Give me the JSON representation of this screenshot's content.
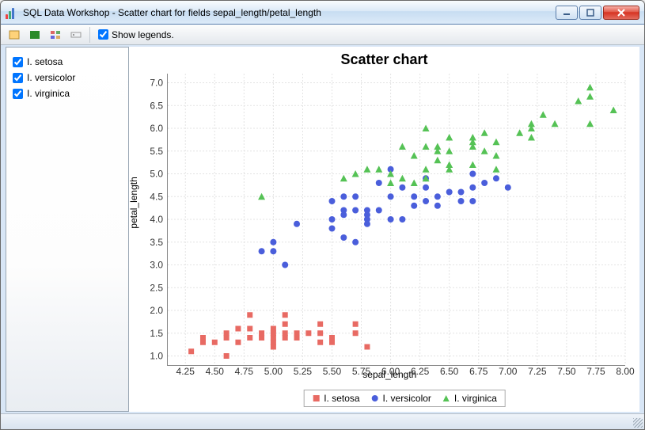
{
  "window": {
    "title": "SQL Data Workshop - Scatter chart for fields sepal_length/petal_length"
  },
  "toolbar": {
    "show_legends_label": "Show legends."
  },
  "sidebar": {
    "items": [
      {
        "label": "I. setosa",
        "checked": true
      },
      {
        "label": "I. versicolor",
        "checked": true
      },
      {
        "label": "I. virginica",
        "checked": true
      }
    ]
  },
  "chart": {
    "title": "Scatter chart",
    "xlabel": "sepal_length",
    "ylabel": "petal_length",
    "legend": [
      "I. setosa",
      "I. versicolor",
      "I. virginica"
    ]
  },
  "chart_data": {
    "type": "scatter",
    "xlabel": "sepal_length",
    "ylabel": "petal_length",
    "title": "Scatter chart",
    "xlim": [
      4.1,
      8.0
    ],
    "ylim": [
      0.8,
      7.2
    ],
    "xticks": [
      4.25,
      4.5,
      4.75,
      5.0,
      5.25,
      5.5,
      5.75,
      6.0,
      6.25,
      6.5,
      6.75,
      7.0,
      7.25,
      7.5,
      7.75,
      8.0
    ],
    "yticks": [
      1.0,
      1.5,
      2.0,
      2.5,
      3.0,
      3.5,
      4.0,
      4.5,
      5.0,
      5.5,
      6.0,
      6.5,
      7.0
    ],
    "series": [
      {
        "name": "I. setosa",
        "marker": "square",
        "color": "#e86a63",
        "points": [
          [
            4.3,
            1.1
          ],
          [
            4.4,
            1.3
          ],
          [
            4.4,
            1.4
          ],
          [
            4.5,
            1.3
          ],
          [
            4.6,
            1.0
          ],
          [
            4.6,
            1.4
          ],
          [
            4.6,
            1.5
          ],
          [
            4.7,
            1.3
          ],
          [
            4.7,
            1.6
          ],
          [
            4.8,
            1.4
          ],
          [
            4.8,
            1.6
          ],
          [
            4.8,
            1.9
          ],
          [
            4.9,
            1.4
          ],
          [
            4.9,
            1.5
          ],
          [
            5.0,
            1.2
          ],
          [
            5.0,
            1.3
          ],
          [
            5.0,
            1.4
          ],
          [
            5.0,
            1.5
          ],
          [
            5.0,
            1.6
          ],
          [
            5.1,
            1.4
          ],
          [
            5.1,
            1.5
          ],
          [
            5.1,
            1.7
          ],
          [
            5.1,
            1.9
          ],
          [
            5.2,
            1.4
          ],
          [
            5.2,
            1.5
          ],
          [
            5.3,
            1.5
          ],
          [
            5.4,
            1.3
          ],
          [
            5.4,
            1.5
          ],
          [
            5.4,
            1.7
          ],
          [
            5.5,
            1.3
          ],
          [
            5.5,
            1.4
          ],
          [
            5.7,
            1.5
          ],
          [
            5.7,
            1.7
          ],
          [
            5.8,
            1.2
          ]
        ]
      },
      {
        "name": "I. versicolor",
        "marker": "circle",
        "color": "#4a5edb",
        "points": [
          [
            4.9,
            3.3
          ],
          [
            5.0,
            3.3
          ],
          [
            5.0,
            3.5
          ],
          [
            5.1,
            3.0
          ],
          [
            5.2,
            3.9
          ],
          [
            5.5,
            3.8
          ],
          [
            5.5,
            4.0
          ],
          [
            5.5,
            4.4
          ],
          [
            5.6,
            3.6
          ],
          [
            5.6,
            4.1
          ],
          [
            5.6,
            4.2
          ],
          [
            5.6,
            4.5
          ],
          [
            5.7,
            3.5
          ],
          [
            5.7,
            4.2
          ],
          [
            5.7,
            4.5
          ],
          [
            5.8,
            3.9
          ],
          [
            5.8,
            4.0
          ],
          [
            5.8,
            4.1
          ],
          [
            5.8,
            4.2
          ],
          [
            5.9,
            4.2
          ],
          [
            5.9,
            4.8
          ],
          [
            6.0,
            4.0
          ],
          [
            6.0,
            4.5
          ],
          [
            6.0,
            5.1
          ],
          [
            6.1,
            4.0
          ],
          [
            6.1,
            4.7
          ],
          [
            6.2,
            4.3
          ],
          [
            6.2,
            4.5
          ],
          [
            6.3,
            4.4
          ],
          [
            6.3,
            4.7
          ],
          [
            6.3,
            4.9
          ],
          [
            6.4,
            4.3
          ],
          [
            6.4,
            4.5
          ],
          [
            6.5,
            4.6
          ],
          [
            6.6,
            4.4
          ],
          [
            6.6,
            4.6
          ],
          [
            6.7,
            4.4
          ],
          [
            6.7,
            4.7
          ],
          [
            6.7,
            5.0
          ],
          [
            6.8,
            4.8
          ],
          [
            6.9,
            4.9
          ],
          [
            7.0,
            4.7
          ]
        ]
      },
      {
        "name": "I. virginica",
        "marker": "triangle",
        "color": "#55c255",
        "points": [
          [
            4.9,
            4.5
          ],
          [
            5.6,
            4.9
          ],
          [
            5.7,
            5.0
          ],
          [
            5.8,
            5.1
          ],
          [
            5.9,
            5.1
          ],
          [
            6.0,
            4.8
          ],
          [
            6.0,
            5.0
          ],
          [
            6.1,
            4.9
          ],
          [
            6.1,
            5.6
          ],
          [
            6.2,
            4.8
          ],
          [
            6.2,
            5.4
          ],
          [
            6.3,
            4.9
          ],
          [
            6.3,
            5.1
          ],
          [
            6.3,
            5.6
          ],
          [
            6.3,
            6.0
          ],
          [
            6.4,
            5.3
          ],
          [
            6.4,
            5.5
          ],
          [
            6.4,
            5.6
          ],
          [
            6.5,
            5.1
          ],
          [
            6.5,
            5.2
          ],
          [
            6.5,
            5.5
          ],
          [
            6.5,
            5.8
          ],
          [
            6.7,
            5.2
          ],
          [
            6.7,
            5.6
          ],
          [
            6.7,
            5.7
          ],
          [
            6.7,
            5.8
          ],
          [
            6.8,
            5.5
          ],
          [
            6.8,
            5.9
          ],
          [
            6.9,
            5.1
          ],
          [
            6.9,
            5.4
          ],
          [
            6.9,
            5.7
          ],
          [
            7.1,
            5.9
          ],
          [
            7.2,
            5.8
          ],
          [
            7.2,
            6.0
          ],
          [
            7.2,
            6.1
          ],
          [
            7.3,
            6.3
          ],
          [
            7.4,
            6.1
          ],
          [
            7.6,
            6.6
          ],
          [
            7.7,
            6.1
          ],
          [
            7.7,
            6.7
          ],
          [
            7.7,
            6.9
          ],
          [
            7.9,
            6.4
          ]
        ]
      }
    ]
  }
}
